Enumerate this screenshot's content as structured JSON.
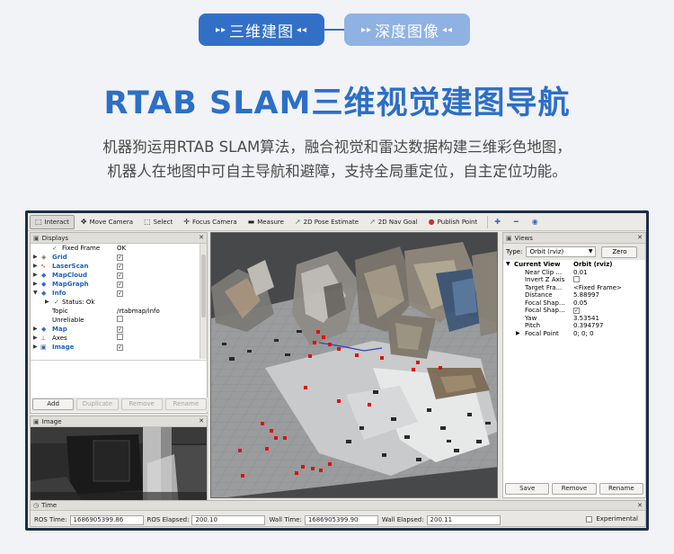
{
  "header": {
    "pill1": "三维建图",
    "pill2": "深度图像",
    "arrow_left": "▸▸",
    "arrow_right": "◂◂",
    "title": "RTAB SLAM三维视觉建图导航",
    "desc_line1": "机器狗运用RTAB SLAM算法，融合视觉和雷达数据构建三维彩色地图，",
    "desc_line2": "机器人在地图中可自主导航和避障，支持全局重定位，自主定位功能。"
  },
  "toolbar": {
    "items": [
      {
        "label": "Interact",
        "icon": "interact-icon"
      },
      {
        "label": "Move Camera",
        "icon": "move-camera-icon"
      },
      {
        "label": "Select",
        "icon": "select-icon"
      },
      {
        "label": "Focus Camera",
        "icon": "focus-camera-icon"
      },
      {
        "label": "Measure",
        "icon": "measure-icon"
      },
      {
        "label": "2D Pose Estimate",
        "icon": "pose-estimate-icon"
      },
      {
        "label": "2D Nav Goal",
        "icon": "nav-goal-icon"
      },
      {
        "label": "Publish Point",
        "icon": "publish-point-icon"
      }
    ]
  },
  "displays": {
    "title": "Displays",
    "fixed_frame_label": "Fixed Frame",
    "fixed_frame_value": "OK",
    "items": [
      "Grid",
      "LaserScan",
      "MapCloud",
      "MapGraph",
      "Info"
    ],
    "status_label": "Status: Ok",
    "topic_label": "Topic",
    "topic_value": "/rtabmap/info",
    "unreliable_label": "Unreliable",
    "items2": [
      "Map",
      "Axes",
      "Image"
    ],
    "buttons": {
      "add": "Add",
      "duplicate": "Duplicate",
      "remove": "Remove",
      "rename": "Rename"
    }
  },
  "image_panel": {
    "title": "Image"
  },
  "views": {
    "title": "Views",
    "type_label": "Type:",
    "type_value": "Orbit (rviz)",
    "zero_label": "Zero",
    "current_view_label": "Current View",
    "current_view_value": "Orbit (rviz)",
    "props": [
      {
        "name": "Near Clip ...",
        "value": "0.01"
      },
      {
        "name": "Invert Z Axis",
        "value": ""
      },
      {
        "name": "Target Fra...",
        "value": "<Fixed Frame>"
      },
      {
        "name": "Distance",
        "value": "5.88997"
      },
      {
        "name": "Focal Shap...",
        "value": "0.05"
      },
      {
        "name": "Focal Shap...",
        "value": "✓"
      },
      {
        "name": "Yaw",
        "value": "3.53541"
      },
      {
        "name": "Pitch",
        "value": "0.394797"
      }
    ],
    "focal_point_label": "Focal Point",
    "focal_point_value": "0; 0; 0",
    "buttons": {
      "save": "Save",
      "remove": "Remove",
      "rename": "Rename"
    }
  },
  "time": {
    "title": "Time",
    "ros_time_label": "ROS Time:",
    "ros_time_value": "1686905399.86",
    "ros_elapsed_label": "ROS Elapsed:",
    "ros_elapsed_value": "200.10",
    "wall_time_label": "Wall Time:",
    "wall_time_value": "1686905399.90",
    "wall_elapsed_label": "Wall Elapsed:",
    "wall_elapsed_value": "200.11",
    "experimental_label": "Experimental"
  },
  "colors": {
    "accent": "#3270c8",
    "accent_light": "#8fb2e2",
    "headline": "#2c6fc7",
    "frame": "#1d2d45"
  }
}
